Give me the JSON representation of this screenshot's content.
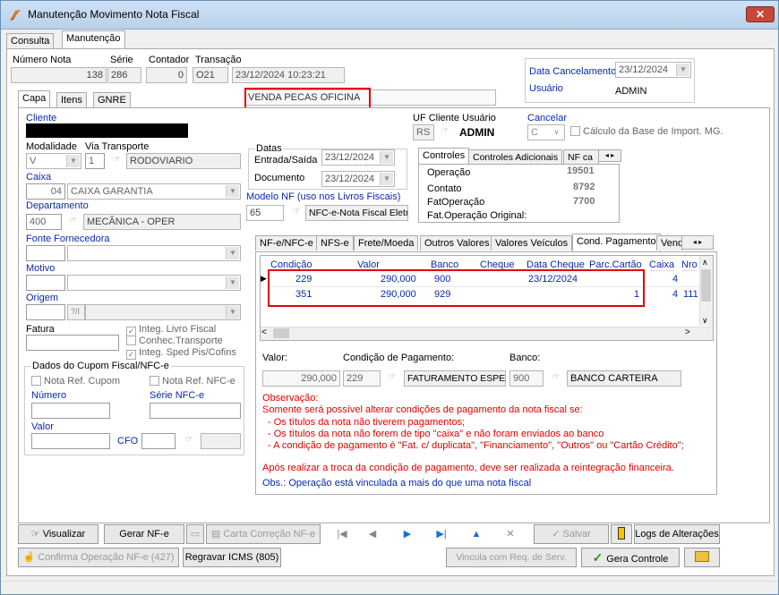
{
  "window": {
    "title": "Manutenção Movimento Nota Fiscal",
    "close": "✕"
  },
  "top_tabs": [
    "Consulta",
    "Manutenção"
  ],
  "header": {
    "numero_nota_label": "Número Nota",
    "numero_nota": "138",
    "serie_label": "Série",
    "serie": "286",
    "contador_label": "Contador",
    "contador": "0",
    "transacao_label": "Transação",
    "transacao": "O21",
    "datetime": "23/12/2024 10:23:21",
    "data_cancel_label": "Data Cancelamento",
    "data_cancel": "23/12/2024",
    "usuario_label": "Usuário",
    "usuario": "ADMIN"
  },
  "sub_tabs": [
    "Capa",
    "Itens",
    "GNRE"
  ],
  "operacao_desc": "VENDA PECAS OFICINA",
  "left": {
    "cliente_label": "Cliente",
    "modalidade_label": "Modalidade",
    "modalidade": "V",
    "via_label": "Via Transporte",
    "via_num": "1",
    "via_desc": "RODOVIARIO",
    "caixa_label": "Caixa",
    "caixa_num": "04",
    "caixa_desc": "CAIXA GARANTIA",
    "depto_label": "Departamento",
    "depto_num": "400",
    "depto_desc": "MECÂNICA - OPER",
    "fonte_label": "Fonte Fornecedora",
    "motivo_label": "Motivo",
    "origem_label": "Origem",
    "origem_code": "?/I",
    "fatura_label": "Fatura",
    "integ_livro": "Integ. Livro Fiscal",
    "conhec": "Conhec.Transporte",
    "integ_sped": "Integ. Sped Pis/Cofins",
    "cupom_title": "Dados do Cupom Fiscal/NFC-e",
    "nota_ref_cupom": "Nota Ref. Cupom",
    "nota_ref_nfce": "Nota Ref. NFC-e",
    "numero_label": "Número",
    "serie_nfce_label": "Série NFC-e",
    "valor_label": "Valor",
    "cfo_label": "CFO"
  },
  "mid": {
    "uf_label": "UF Cliente",
    "uf": "RS",
    "usuario_label": "Usuário",
    "usuario": "ADMIN",
    "cancelar_label": "Cancelar",
    "cancelar": "C",
    "calc_base": "Cálculo da Base de Import. MG.",
    "datas_label": "Datas",
    "entrada_label": "Entrada/Saída",
    "entrada": "23/12/2024",
    "documento_label": "Documento",
    "documento": "23/12/2024",
    "modelo_label": "Modelo NF (uso nos Livros Fiscais)",
    "modelo_num": "65",
    "modelo_desc": "NFC-e-Nota Fiscal Eletr"
  },
  "controles": {
    "tabs": [
      "Controles",
      "Controles Adicionais",
      "NF ca"
    ],
    "rows": [
      {
        "label": "Operação",
        "value": "19501"
      },
      {
        "label": "Contato",
        "value": "8792"
      },
      {
        "label": "FatOperação",
        "value": "7700"
      },
      {
        "label": "Fat.Operação Original:",
        "value": ""
      }
    ]
  },
  "bottom_tabs": [
    "NF-e/NFC-e",
    "NFS-e",
    "Frete/Moeda",
    "Outros Valores",
    "Valores Veículos",
    "Cond. Pagamento",
    "Vende"
  ],
  "grid": {
    "headers": [
      "Condição",
      "Valor",
      "Banco",
      "Cheque",
      "Data Cheque",
      "Parc.Cartão",
      "Caixa",
      "Nro"
    ],
    "rows": [
      [
        "229",
        "290,000",
        "900",
        "",
        "23/12/2024",
        "",
        "4",
        ""
      ],
      [
        "351",
        "290,000",
        "929",
        "",
        "",
        "1",
        "4",
        "111"
      ]
    ]
  },
  "pagamento": {
    "valor_label": "Valor:",
    "valor": "290,000",
    "cond_label": "Condição de Pagamento:",
    "cond_num": "229",
    "cond_desc": "FATURAMENTO ESPEC",
    "banco_label": "Banco:",
    "banco_num": "900",
    "banco_desc": "BANCO CARTEIRA"
  },
  "obs": {
    "title": "Observação:",
    "line1": "Somente será possível alterar condições de pagamento da nota fiscal se:",
    "line2": "- Os títulos da nota não tiverem pagamentos;",
    "line3": "- Os títulos da nota não forem de tipo \"caixa\" e não foram enviados ao banco",
    "line4": "- A condição de pagamento é \"Fat. c/ duplicata\", \"Financiamento\", \"Outros\" ou \"Cartão Crédito\";",
    "line5": "Após realizar a troca da condição de pagamento, deve ser realizada a reintegração financeira.",
    "line6": "Obs.: Operação está vinculada a mais do que uma nota fiscal"
  },
  "buttons": {
    "visualizar": "Visualizar",
    "gerar_nfe": "Gerar NF-e",
    "carta": "Carta Correção NF-e",
    "salvar": "Salvar",
    "logs": "Logs de Alterações",
    "confirma": "Confirma Operação NF-e (427)",
    "regravar": "Regravar ICMS (805)",
    "vincula": "Vincula com Req. de Serv.",
    "gera_controle": "Gera Controle"
  },
  "colors": {
    "accent_red": "#e00000",
    "label_blue": "#0a2aa8",
    "title_bar": "#c4d9ef"
  }
}
